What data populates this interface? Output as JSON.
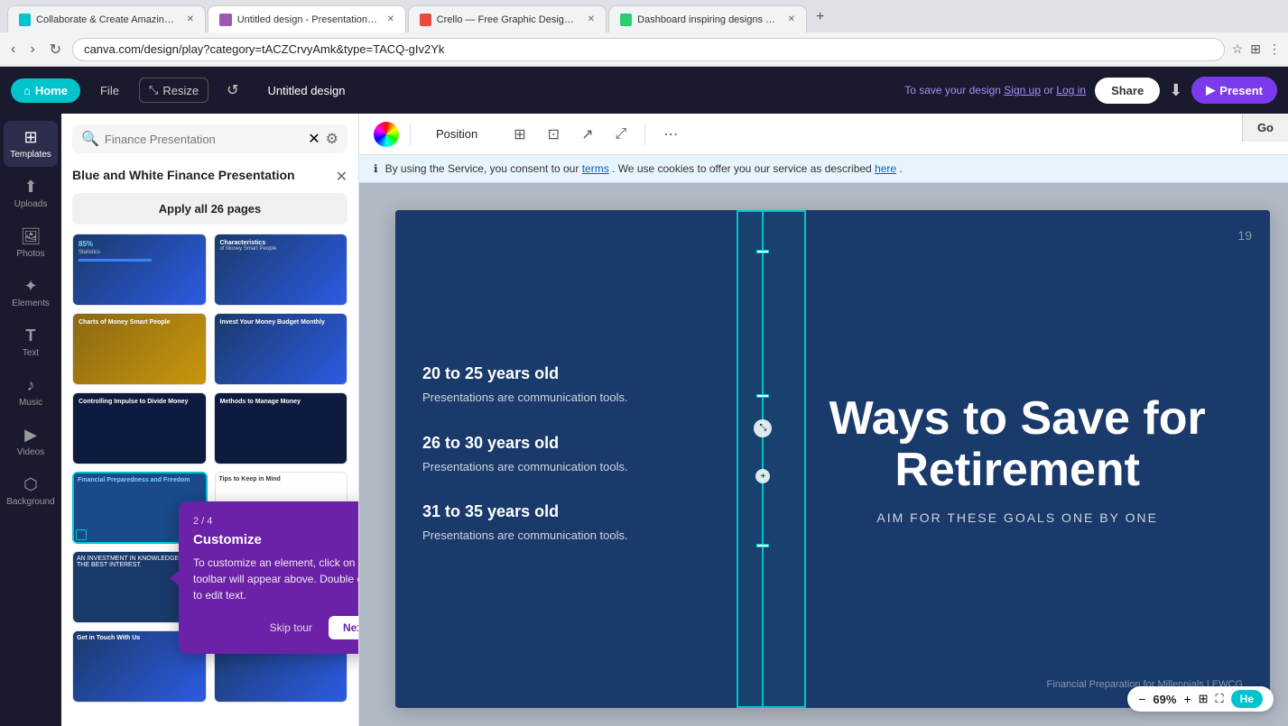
{
  "browser": {
    "tabs": [
      {
        "id": "tab1",
        "title": "Collaborate & Create Amazing C...",
        "favicon_color": "#00c4cc",
        "active": false
      },
      {
        "id": "tab2",
        "title": "Untitled design - Presentation |...",
        "favicon_color": "#9b59b6",
        "active": true
      },
      {
        "id": "tab3",
        "title": "Crello — Free Graphic Design Se...",
        "favicon_color": "#e74c3c",
        "active": false
      },
      {
        "id": "tab4",
        "title": "Dashboard inspiring designs - G...",
        "favicon_color": "#2ecc71",
        "active": false
      }
    ],
    "address": "canva.com/design/play?category=tACZCrvyAmk&type=TACQ-gIv2Yk",
    "nav": {
      "back": "‹",
      "forward": "›",
      "refresh": "↻"
    }
  },
  "topbar": {
    "home_label": "Home",
    "file_label": "File",
    "resize_label": "Resize",
    "undo_label": "↺",
    "title": "Untitled design",
    "save_text": "To save your design ",
    "sign_up_label": "Sign up",
    "or_label": " or ",
    "log_in_label": "Log in",
    "share_label": "Share",
    "download_label": "⬇",
    "present_label": "Present"
  },
  "sidebar": {
    "items": [
      {
        "id": "templates",
        "icon": "⊞",
        "label": "Templates",
        "active": true
      },
      {
        "id": "uploads",
        "icon": "⬆",
        "label": "Uploads"
      },
      {
        "id": "photos",
        "icon": "🖼",
        "label": "Photos"
      },
      {
        "id": "elements",
        "icon": "✦",
        "label": "Elements"
      },
      {
        "id": "text",
        "icon": "T",
        "label": "Text"
      },
      {
        "id": "music",
        "icon": "♪",
        "label": "Music"
      },
      {
        "id": "videos",
        "icon": "▶",
        "label": "Videos"
      },
      {
        "id": "background",
        "icon": "⬡",
        "label": "Background"
      }
    ]
  },
  "template_panel": {
    "search_placeholder": "Finance Presentation",
    "title": "Blue and White Finance Presentation",
    "close_icon": "✕",
    "apply_label": "Apply all 26 pages",
    "templates": [
      {
        "row": 1,
        "items": [
          {
            "id": "t1",
            "style": "blue_stats",
            "badge": ""
          },
          {
            "id": "t2",
            "style": "blue_text",
            "badge": ""
          }
        ]
      },
      {
        "row": 2,
        "items": [
          {
            "id": "t3",
            "style": "dark_photo",
            "badge": ""
          },
          {
            "id": "t4",
            "style": "blue_list",
            "badge": ""
          }
        ]
      },
      {
        "row": 3,
        "items": [
          {
            "id": "t5",
            "style": "dark_control",
            "badge": ""
          },
          {
            "id": "t6",
            "style": "dark_method",
            "badge": ""
          }
        ]
      },
      {
        "row": 4,
        "items": [
          {
            "id": "t7",
            "style": "blue_finance",
            "badge": ""
          },
          {
            "id": "t8",
            "style": "white_tips",
            "badge": ""
          }
        ]
      },
      {
        "row": 5,
        "items": [
          {
            "id": "t9",
            "style": "dark_invest",
            "badge": ""
          },
          {
            "id": "t10",
            "style": "dark_wise",
            "badge": ""
          }
        ]
      },
      {
        "row": 6,
        "items": [
          {
            "id": "t11",
            "style": "blue_get",
            "badge": ""
          },
          {
            "id": "t12",
            "style": "blue_pres",
            "badge": ""
          }
        ]
      }
    ]
  },
  "tour_popup": {
    "counter": "2 / 4",
    "title": "Customize",
    "body": "To customize an element, click on it. A toolbar will appear above. Double click to edit text.",
    "skip_label": "Skip tour",
    "next_label": "Next"
  },
  "canvas_toolbar": {
    "position_label": "Position",
    "icons": [
      "⊞",
      "⊡",
      "↗",
      "↗"
    ]
  },
  "cookie_banner": {
    "text_before": "By using the Service, you consent to our ",
    "terms_link": "terms",
    "text_middle": ". We use cookies to offer you our service as described ",
    "here_link": "here",
    "text_after": ".",
    "dismiss_label": "Go"
  },
  "slide": {
    "page_number": "19",
    "age_groups": [
      {
        "label": "20 to 25 years old",
        "description": "Presentations are communication tools."
      },
      {
        "label": "26 to 30 years old",
        "description": "Presentations are communication tools."
      },
      {
        "label": "31 to 35 years old",
        "description": "Presentations are communication tools."
      }
    ],
    "main_title": "Ways to Save for Retirement",
    "main_subtitle": "AIM FOR THESE GOALS ONE BY ONE",
    "footer": "Financial Preparation for Millennials | EWCG",
    "bg_color": "#1a3a6b",
    "accent_color": "#00c4cc"
  },
  "bottom_bar": {
    "zoom": "69%",
    "page_icon": "⊞",
    "expand_icon": "⛶"
  }
}
